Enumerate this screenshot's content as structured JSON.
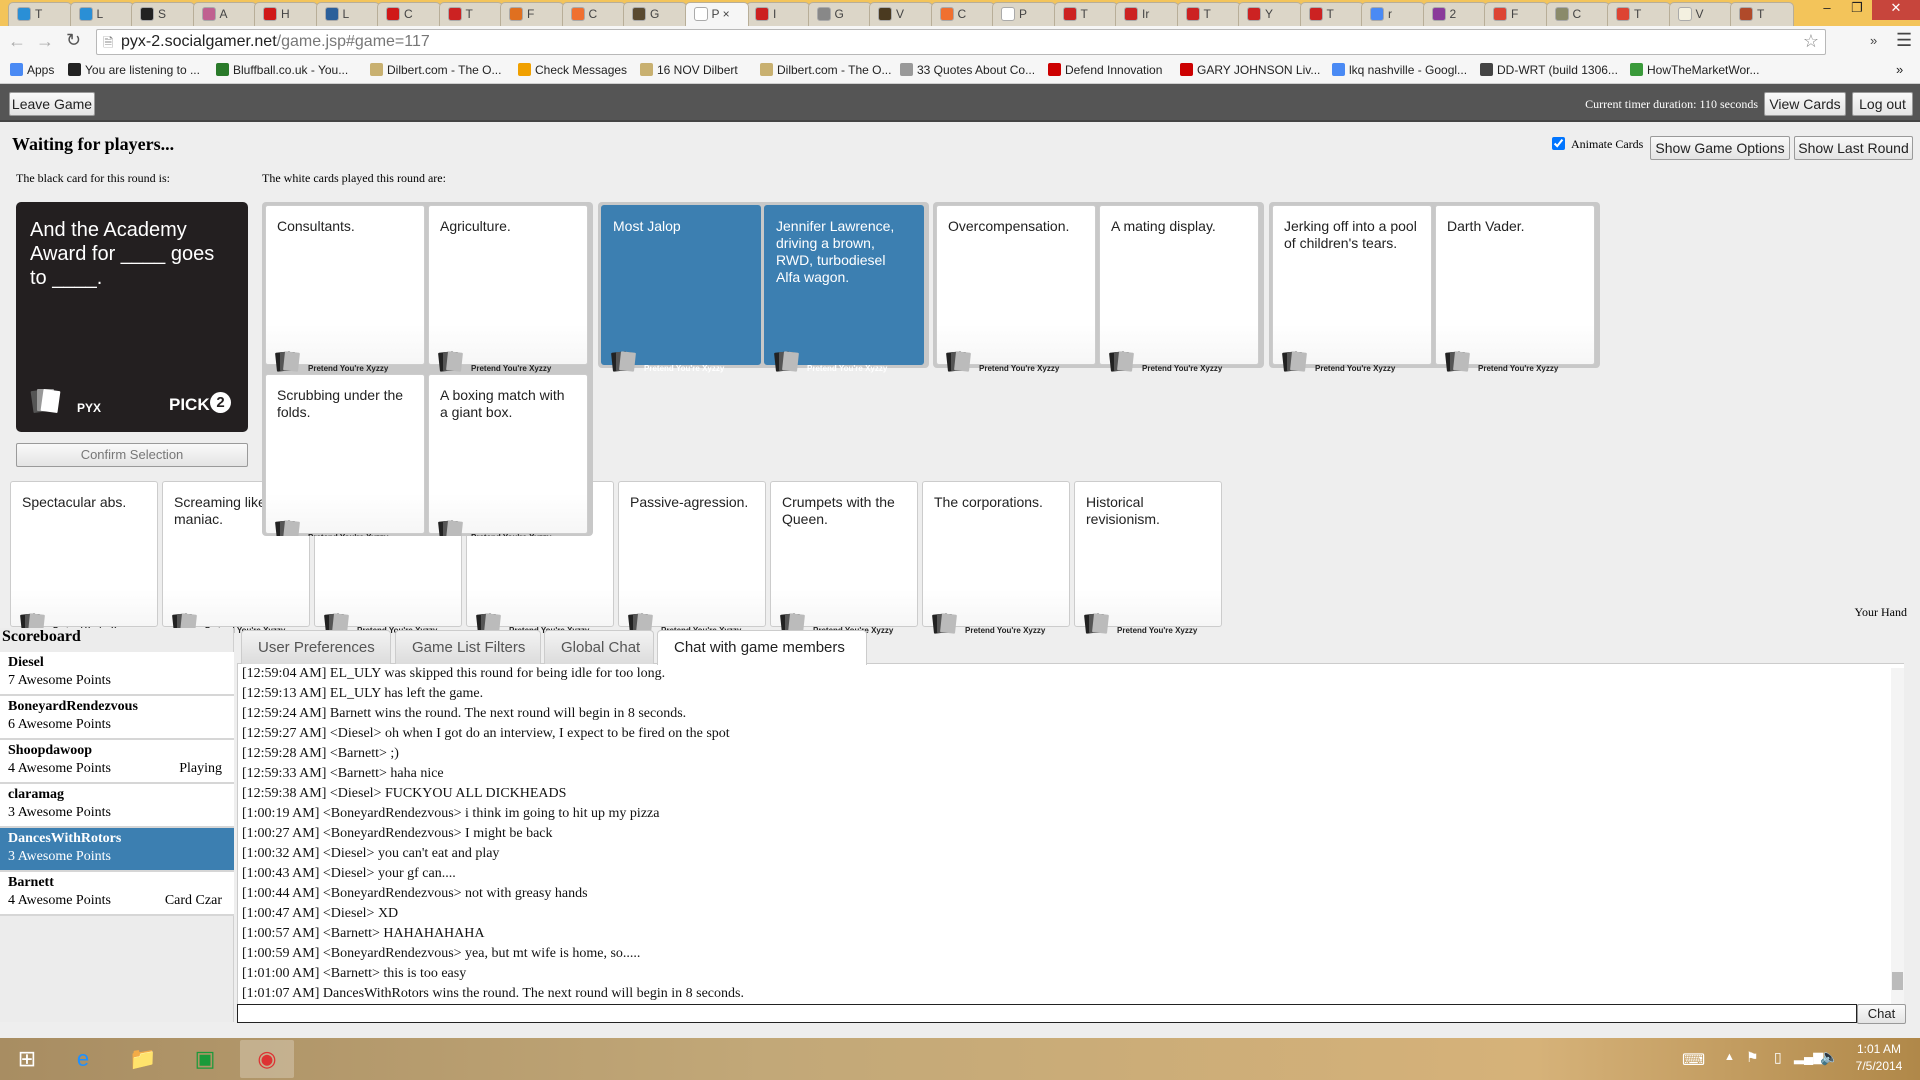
{
  "browser": {
    "tabs": [
      {
        "label": "T",
        "color": "#2a8fd6"
      },
      {
        "label": "L",
        "color": "#2a8fd6"
      },
      {
        "label": "S",
        "color": "#222"
      },
      {
        "label": "A",
        "color": "#c06090"
      },
      {
        "label": "H",
        "color": "#d01818"
      },
      {
        "label": "L",
        "color": "#2a5f9a"
      },
      {
        "label": "C",
        "color": "#d01818"
      },
      {
        "label": "T",
        "color": "#cc2222"
      },
      {
        "label": "F",
        "color": "#e07020"
      },
      {
        "label": "C",
        "color": "#f07030"
      },
      {
        "label": "G",
        "color": "#5a4a30"
      },
      {
        "label": "P",
        "color": "#ffffff",
        "active": true,
        "closable": true
      },
      {
        "label": "I",
        "color": "#cc2020"
      },
      {
        "label": "G",
        "color": "#888"
      },
      {
        "label": "V",
        "color": "#4a3a20"
      },
      {
        "label": "C",
        "color": "#f07030"
      },
      {
        "label": "P",
        "color": "#ffffff"
      },
      {
        "label": "T",
        "color": "#cc2222"
      },
      {
        "label": "Ir",
        "color": "#cc2222"
      },
      {
        "label": "T",
        "color": "#cc2222"
      },
      {
        "label": "Y",
        "color": "#cc2222"
      },
      {
        "label": "T",
        "color": "#cc2222"
      },
      {
        "label": "r",
        "color": "#4a8af4"
      },
      {
        "label": "2",
        "color": "#8a3a9a"
      },
      {
        "label": "F",
        "color": "#dd4433"
      },
      {
        "label": "C",
        "color": "#8a8a6a"
      },
      {
        "label": "T",
        "color": "#dd4433"
      },
      {
        "label": "V",
        "color": "#f4f0e0"
      },
      {
        "label": "T",
        "color": "#b04a2a"
      }
    ],
    "url_host": "pyx-2.socialgamer.net",
    "url_path": "/game.jsp#game=117",
    "bookmarks": [
      {
        "label": "Apps",
        "color": "#4a8af4"
      },
      {
        "label": "You are listening to ...",
        "color": "#222"
      },
      {
        "label": "Bluffball.co.uk - You...",
        "color": "#2a7a2a"
      },
      {
        "label": "Dilbert.com - The O...",
        "color": "#c8b070"
      },
      {
        "label": "Check Messages",
        "color": "#f0a000"
      },
      {
        "label": "16 NOV Dilbert",
        "color": "#c8b070"
      },
      {
        "label": "Dilbert.com - The O...",
        "color": "#c8b070"
      },
      {
        "label": "33 Quotes About Co...",
        "color": "#999"
      },
      {
        "label": "Defend Innovation",
        "color": "#cc0000"
      },
      {
        "label": "GARY JOHNSON Liv...",
        "color": "#cc0000"
      },
      {
        "label": "lkq nashville - Googl...",
        "color": "#4a8af4"
      },
      {
        "label": "DD-WRT (build 1306...",
        "color": "#444"
      },
      {
        "label": "HowTheMarketWor...",
        "color": "#3a9a3a"
      }
    ]
  },
  "header": {
    "leave_game": "Leave Game",
    "timer": "Current timer duration: 110 seconds",
    "view_cards": "View Cards",
    "log_out": "Log out"
  },
  "game": {
    "status": "Waiting for players...",
    "animate_cards_label": "Animate Cards",
    "animate_cards_checked": true,
    "show_game_options": "Show Game Options",
    "show_last_round": "Show Last Round",
    "black_card_label": "The black card for this round is:",
    "white_cards_label": "The white cards played this round are:",
    "black_card": {
      "text": "And the Academy Award for ____ goes to ____.",
      "brand": "PYX",
      "pick_label": "PICK",
      "pick": "2"
    },
    "confirm_selection": "Confirm Selection",
    "card_brand": "Pretend You're Xyzzy",
    "played_groups": [
      {
        "cards": [
          "Consultants.",
          "Agriculture.",
          "Scrubbing under the folds.",
          "A boxing match with a giant box."
        ],
        "selected": false
      },
      {
        "cards": [
          "Most Jalop",
          "Jennifer Lawrence, driving a brown, RWD, turbodiesel Alfa wagon."
        ],
        "selected": true
      },
      {
        "cards": [
          "Overcompensation.",
          "A mating display."
        ],
        "selected": false
      },
      {
        "cards": [
          "Jerking off into a pool of children's tears.",
          "Darth Vader."
        ],
        "selected": false
      }
    ],
    "hand": [
      "Spectacular abs.",
      "Screaming like a maniac.",
      "",
      "",
      "Passive-agression.",
      "Crumpets with the Queen.",
      "The corporations.",
      "Historical revisionism."
    ],
    "your_hand_label": "Your Hand"
  },
  "scoreboard": {
    "title": "Scoreboard",
    "players": [
      {
        "name": "Diesel",
        "points": "7 Awesome Points",
        "status": ""
      },
      {
        "name": "BoneyardRendezvous",
        "points": "6 Awesome Points",
        "status": ""
      },
      {
        "name": "Shoopdawoop",
        "points": "4 Awesome Points",
        "status": "Playing"
      },
      {
        "name": "claramag",
        "points": "3 Awesome Points",
        "status": ""
      },
      {
        "name": "DancesWithRotors",
        "points": "3 Awesome Points",
        "status": "",
        "self": true
      },
      {
        "name": "Barnett",
        "points": "4 Awesome Points",
        "status": "Card Czar"
      }
    ]
  },
  "bottom_tabs": [
    {
      "label": "User Preferences"
    },
    {
      "label": "Game List Filters"
    },
    {
      "label": "Global Chat"
    },
    {
      "label": "Chat with game members",
      "active": true
    }
  ],
  "chat": {
    "lines": [
      "[12:59:04 AM] EL_ULY was skipped this round for being idle for too long.",
      "[12:59:13 AM] EL_ULY has left the game.",
      "[12:59:24 AM] Barnett wins the round. The next round will begin in 8 seconds.",
      "[12:59:27 AM] <Diesel> oh when I got do an interview, I expect to be fired on the spot",
      "[12:59:28 AM] <Barnett> ;)",
      "[12:59:33 AM] <Barnett> haha nice",
      "[12:59:38 AM] <Diesel> FUCKYOU ALL DICKHEADS",
      "[1:00:19 AM] <BoneyardRendezvous> i think im going to hit up my pizza",
      "[1:00:27 AM] <BoneyardRendezvous> I might be back",
      "[1:00:32 AM] <Diesel> you can't eat and play",
      "[1:00:43 AM] <Diesel> your gf can....",
      "[1:00:44 AM] <BoneyardRendezvous> not with greasy hands",
      "[1:00:47 AM] <Diesel> XD",
      "[1:00:57 AM] <Barnett> HAHAHAHAHA",
      "[1:00:59 AM] <BoneyardRendezvous> yea, but mt wife is home, so.....",
      "[1:01:00 AM] <Barnett> this is too easy",
      "[1:01:07 AM] DancesWithRotors wins the round. The next round will begin in 8 seconds."
    ],
    "input_value": "",
    "send_label": "Chat"
  },
  "taskbar": {
    "time": "1:01 AM",
    "date": "7/5/2014"
  },
  "colors": {
    "selected": "#3c7fb1",
    "black_card": "#231f20",
    "header": "#555555"
  }
}
